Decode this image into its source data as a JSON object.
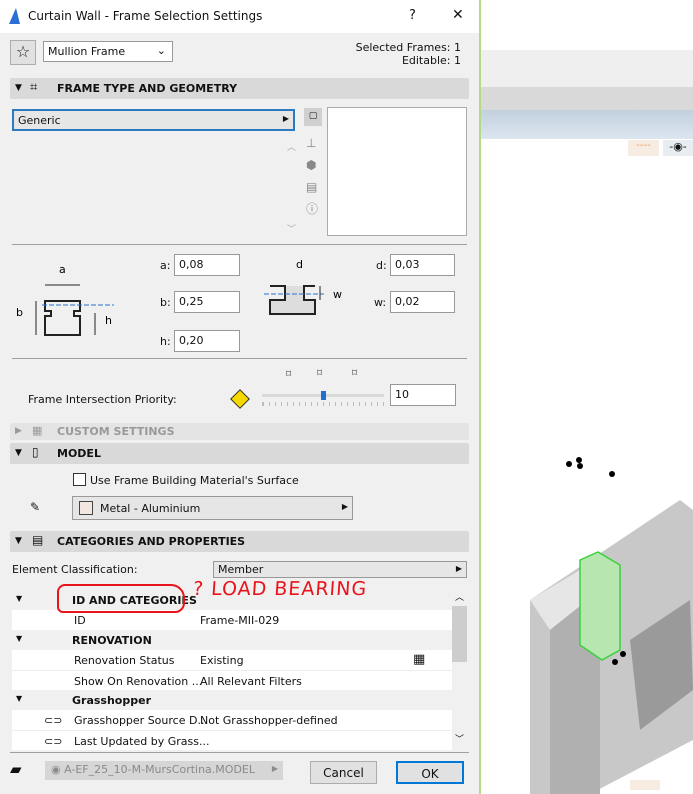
{
  "dialog": {
    "title": "Curtain Wall - Frame Selection Settings",
    "help": "?",
    "close": "✕",
    "preset": "Mullion Frame",
    "selected_frames": "Selected Frames: 1",
    "editable": "Editable: 1"
  },
  "sections": {
    "frame_type": "FRAME TYPE AND GEOMETRY",
    "custom": "CUSTOM SETTINGS",
    "model": "MODEL",
    "categories": "CATEGORIES AND PROPERTIES"
  },
  "frame": {
    "type": "Generic",
    "params": {
      "a_label": "a:",
      "a": "0,08",
      "b_label": "b:",
      "b": "0,25",
      "h_label": "h:",
      "h": "0,20",
      "d_label": "d:",
      "d": "0,03",
      "w_label": "w:",
      "w": "0,02"
    },
    "diagram_labels": {
      "a": "a",
      "b": "b",
      "h": "h",
      "d": "d",
      "w": "w"
    },
    "priority_label": "Frame Intersection Priority:",
    "priority": "10",
    "priority_slider_fraction": 0.5
  },
  "model": {
    "use_building_material": "Use Frame Building Material's Surface",
    "use_building_material_checked": false,
    "material": "Metal - Aluminium"
  },
  "categories": {
    "classification_label": "Element Classification:",
    "classification": "Member",
    "rows": [
      {
        "kind": "group",
        "name": "ID AND CATEGORIES"
      },
      {
        "kind": "prop",
        "name": "ID",
        "value": "Frame-MII-029"
      },
      {
        "kind": "group",
        "name": "RENOVATION"
      },
      {
        "kind": "prop",
        "name": "Renovation Status",
        "value": "Existing"
      },
      {
        "kind": "prop",
        "name": "Show On Renovation ...",
        "value": "All Relevant Filters"
      },
      {
        "kind": "group",
        "name": "Grasshopper"
      },
      {
        "kind": "prop",
        "name": "Grasshopper Source D...",
        "value": "Not Grasshopper-defined"
      },
      {
        "kind": "prop",
        "name": "Last Updated by Grass...",
        "value": ""
      }
    ]
  },
  "annotation": {
    "text": "? LOAD BEARING",
    "color": "#e8141c"
  },
  "footer": {
    "layer": "A-EF_25_10-M-MursCortina.MODEL",
    "cancel": "Cancel",
    "ok": "OK"
  },
  "colors": {
    "accent": "#0078d7",
    "selection": "#3ad13a"
  }
}
